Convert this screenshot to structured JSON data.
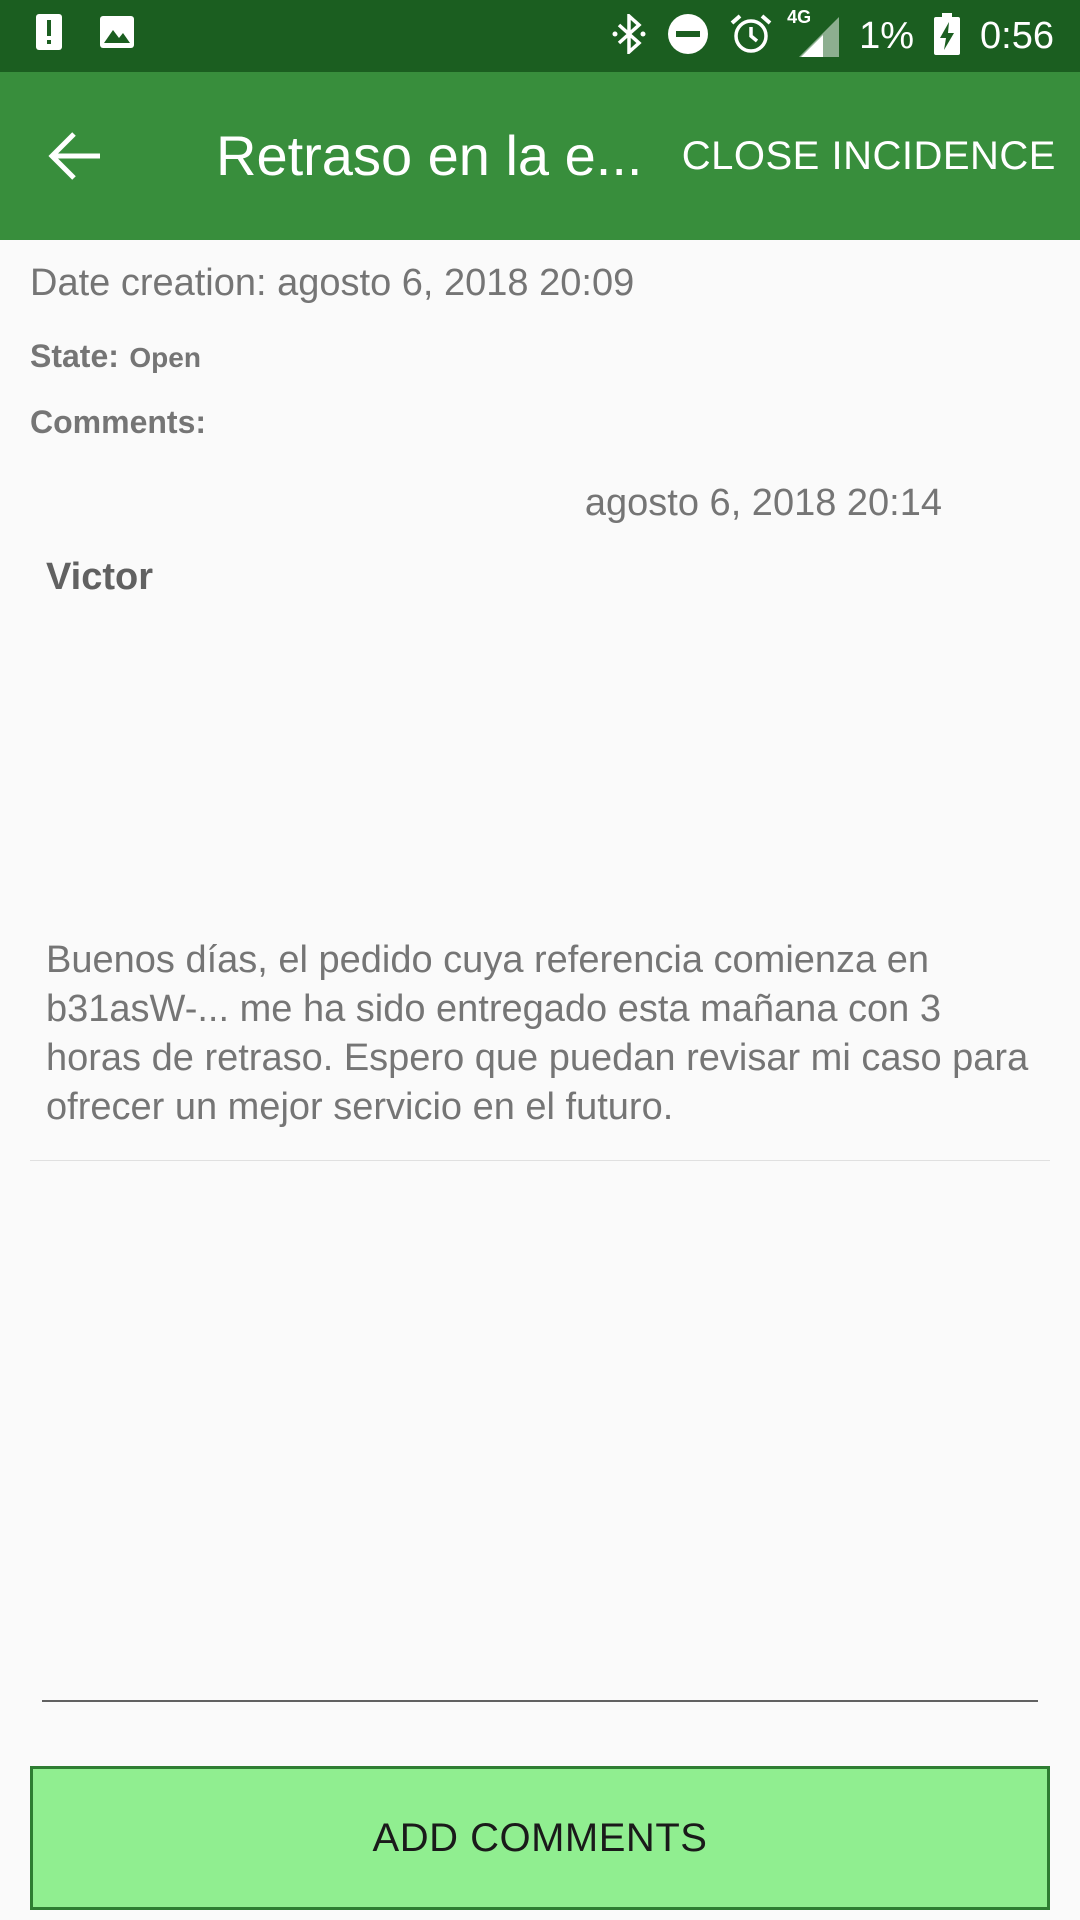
{
  "status_bar": {
    "battery_percent": "1%",
    "time": "0:56",
    "network": "4G",
    "icons": [
      "alert-icon",
      "image-icon",
      "bluetooth-icon",
      "do-not-disturb-icon",
      "alarm-icon",
      "signal-icon",
      "battery-charging-icon"
    ]
  },
  "app_bar": {
    "title": "Retraso en la e...",
    "back_icon": "arrow-back-icon",
    "close_label": "CLOSE INCIDENCE",
    "color": "#388e3c"
  },
  "details": {
    "date_creation": "Date creation: agosto 6, 2018 20:09",
    "state_label": "State:",
    "state_value": "Open",
    "comments_label": "Comments:"
  },
  "comments": [
    {
      "date": "agosto 6, 2018 20:14",
      "author": "Victor",
      "text": "Buenos días, el pedido cuya referencia comienza en b31asW-... me ha sido entregado esta mañana con 3 horas de retraso. Espero que puedan revisar mi caso para ofrecer un mejor servicio en el futuro."
    }
  ],
  "new_comment": {
    "value": ""
  },
  "actions": {
    "add_comments_label": "ADD COMMENTS",
    "add_comments_color": "#90ee90"
  }
}
